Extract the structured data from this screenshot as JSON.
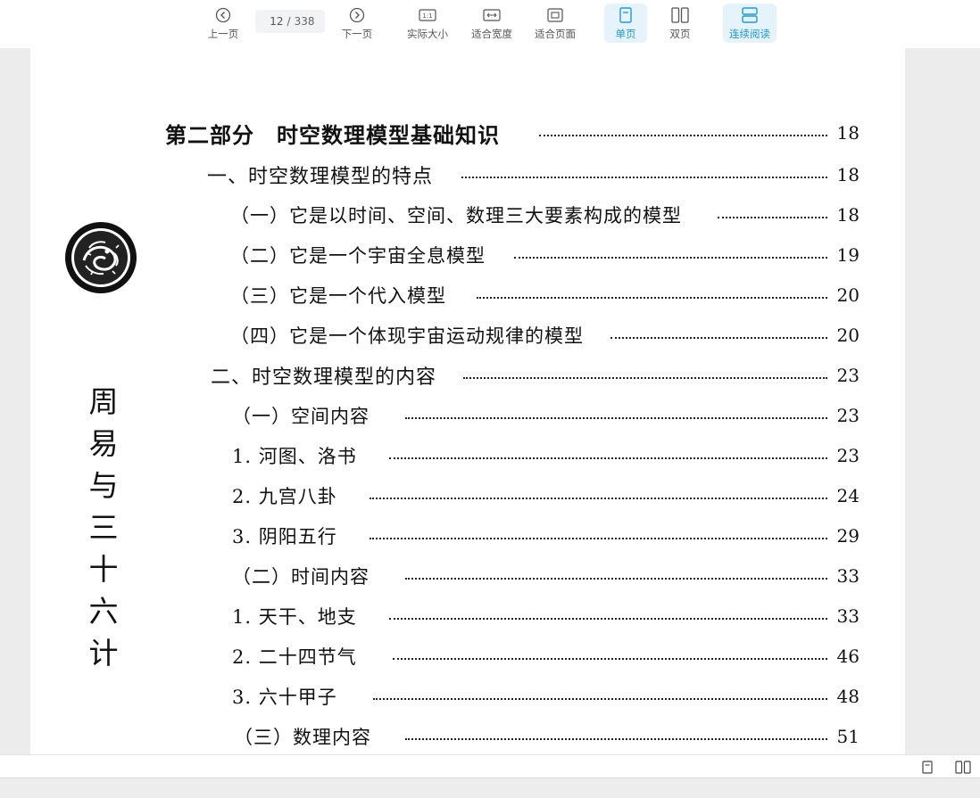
{
  "toolbar": {
    "prev_label": "上一页",
    "next_label": "下一页",
    "page_current": "12",
    "page_separator": "/",
    "page_total": "338",
    "actual_size_label": "实际大小",
    "actual_size_icon_text": "1:1",
    "fit_width_label": "适合宽度",
    "fit_page_label": "适合页面",
    "single_page_label": "单页",
    "double_page_label": "双页",
    "continuous_label": "连续阅读",
    "accent_color": "#1e9ad6"
  },
  "page": {
    "side_title_chars": [
      "周",
      "易",
      "与",
      "三",
      "十",
      "六",
      "计"
    ],
    "toc": [
      {
        "text": "第二部分　时空数理模型基础知识",
        "page": "18",
        "level": "head"
      },
      {
        "text": "一、时空数理模型的特点",
        "page": "18",
        "level": "l1"
      },
      {
        "text": "（一）它是以时间、空间、数理三大要素构成的模型",
        "page": "18",
        "level": "l2"
      },
      {
        "text": "（二）它是一个宇宙全息模型",
        "page": "19",
        "level": "l2"
      },
      {
        "text": "（三）它是一个代入模型",
        "page": "20",
        "level": "l2"
      },
      {
        "text": "（四）它是一个体现宇宙运动规律的模型",
        "page": "20",
        "level": "l2"
      },
      {
        "text": "二、时空数理模型的内容",
        "page": "23",
        "level": "l1"
      },
      {
        "text": "（一）空间内容",
        "page": "23",
        "level": "l2"
      },
      {
        "text": "1. 河图、洛书",
        "page": "23",
        "level": "l2"
      },
      {
        "text": "2. 九宫八卦",
        "page": "24",
        "level": "l2"
      },
      {
        "text": "3. 阴阳五行",
        "page": "29",
        "level": "l2"
      },
      {
        "text": "（二）时间内容",
        "page": "33",
        "level": "l2"
      },
      {
        "text": "1. 天干、地支",
        "page": "33",
        "level": "l2"
      },
      {
        "text": "2. 二十四节气",
        "page": "46",
        "level": "l2"
      },
      {
        "text": "3. 六十甲子",
        "page": "48",
        "level": "l2"
      },
      {
        "text": "（三）数理内容",
        "page": "51",
        "level": "l2"
      }
    ]
  }
}
